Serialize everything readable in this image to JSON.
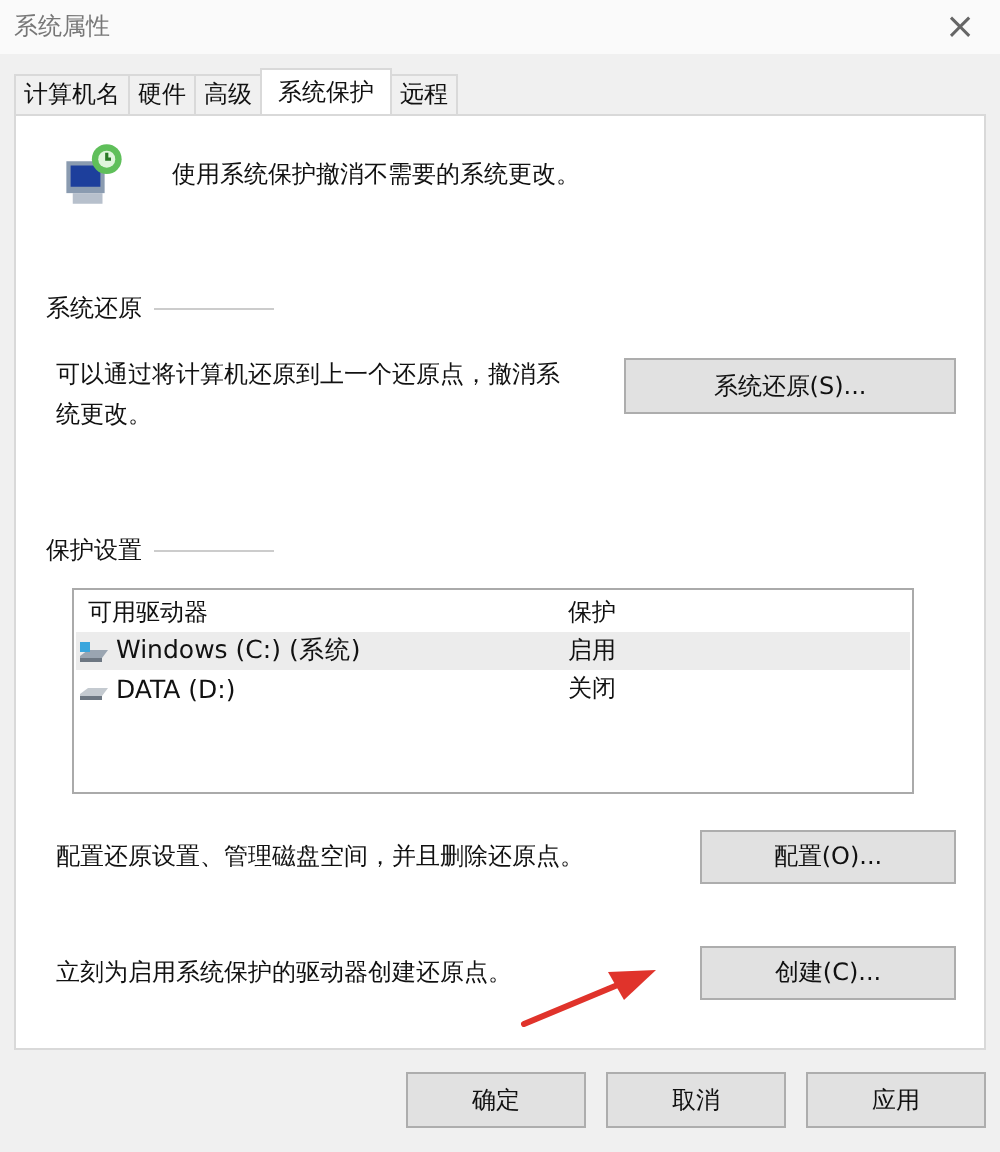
{
  "window": {
    "title": "系统属性",
    "close": "×"
  },
  "tabs": [
    {
      "label": "计算机名",
      "selected": false
    },
    {
      "label": "硬件",
      "selected": false
    },
    {
      "label": "高级",
      "selected": false
    },
    {
      "label": "系统保护",
      "selected": true
    },
    {
      "label": "远程",
      "selected": false
    }
  ],
  "intro": "使用系统保护撤消不需要的系统更改。",
  "restore": {
    "heading": "系统还原",
    "text": "可以通过将计算机还原到上一个还原点，撤消系统更改。",
    "button": "系统还原(S)..."
  },
  "protection": {
    "heading": "保护设置",
    "columns": [
      "可用驱动器",
      "保护"
    ],
    "rows": [
      {
        "kind": "system",
        "name": "Windows (C:) (系统)",
        "status": "启用",
        "selected": true
      },
      {
        "kind": "data",
        "name": "DATA (D:)",
        "status": "关闭",
        "selected": false
      }
    ],
    "configure": {
      "text": "配置还原设置、管理磁盘空间，并且删除还原点。",
      "button": "配置(O)..."
    },
    "create": {
      "text": "立刻为启用系统保护的驱动器创建还原点。",
      "button": "创建(C)..."
    }
  },
  "buttons": [
    "确定",
    "取消",
    "应用"
  ]
}
